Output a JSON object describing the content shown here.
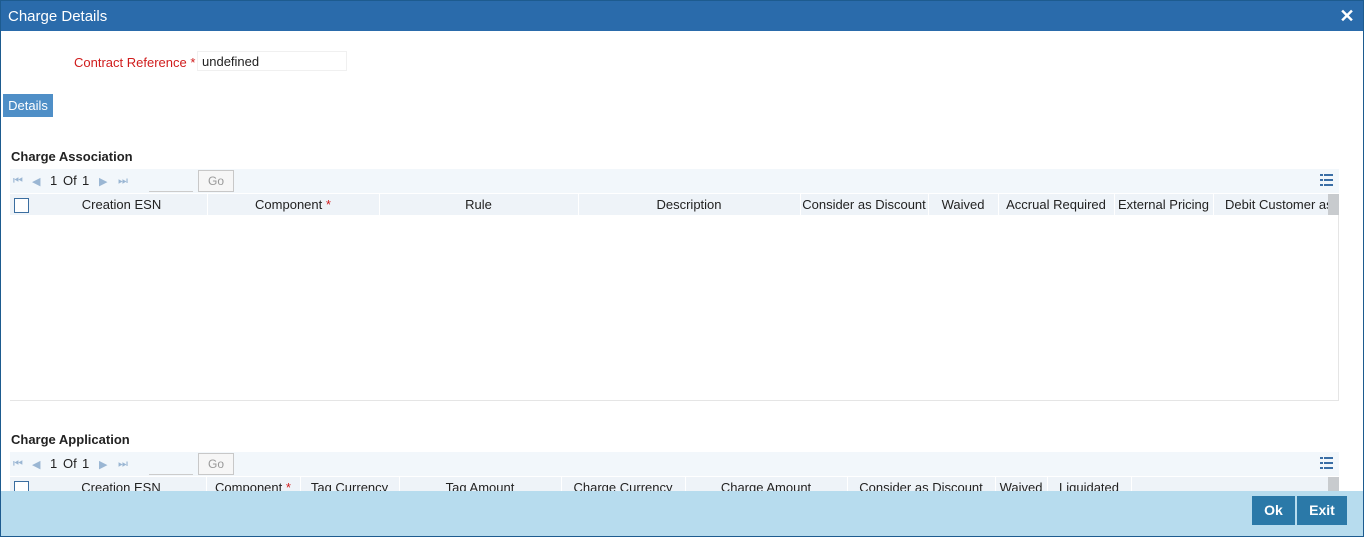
{
  "window": {
    "title": "Charge Details"
  },
  "contract": {
    "label": "Contract Reference",
    "required_mark": "*",
    "value": "undefined"
  },
  "tabs": {
    "details": "Details"
  },
  "charge_association": {
    "title": "Charge Association",
    "pager": {
      "current": "1",
      "of": "Of",
      "total": "1",
      "go": "Go"
    },
    "columns": [
      "Creation ESN",
      "Component",
      "Rule",
      "Description",
      "Consider as Discount",
      "Waived",
      "Accrual Required",
      "External Pricing",
      "Debit Customer as"
    ],
    "required_mark": "*"
  },
  "charge_application": {
    "title": "Charge Application",
    "pager": {
      "current": "1",
      "of": "Of",
      "total": "1",
      "go": "Go"
    },
    "columns": [
      "Creation ESN",
      "Component",
      "Tag Currency",
      "Tag Amount",
      "Charge Currency",
      "Charge Amount",
      "Consider as Discount",
      "Waived",
      "Liquidated"
    ],
    "required_mark": "*"
  },
  "footer": {
    "ok": "Ok",
    "exit": "Exit"
  },
  "colors": {
    "title_bar": "#2a6bab",
    "footer": "#b7dcee",
    "button": "#2b79a8",
    "required": "#d01c1c"
  }
}
